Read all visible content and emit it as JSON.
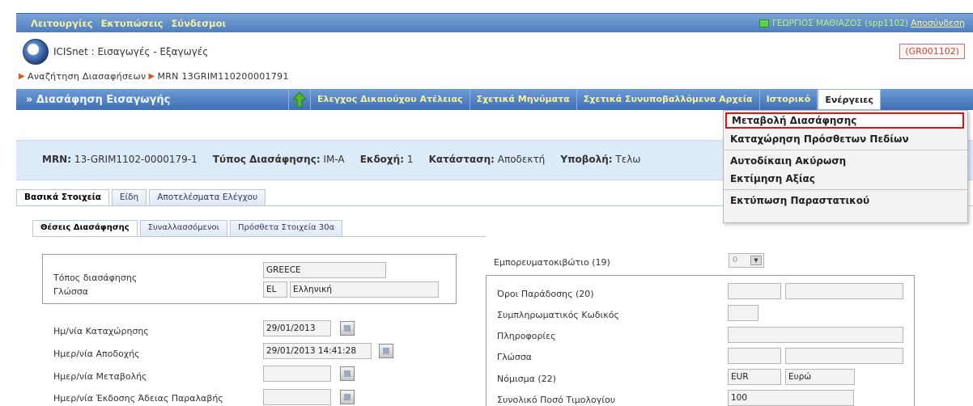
{
  "top_menu": {
    "items": [
      "Λειτουργίες",
      "Εκτυπώσεις",
      "Σύνδεσμοι"
    ],
    "user": "ΓΕΩΡΓΙΟΣ ΜΑΘΙΑΖΟΣ (spp1102)",
    "logout": "Αποσύνδεση"
  },
  "app": {
    "title": "ICISnet : Εισαγωγές - Εξαγωγές",
    "code": "(GR001102)"
  },
  "breadcrumb": [
    "Αναζήτηση Διασαφήσεων",
    "MRN 13GRIM110200001791"
  ],
  "toolbar": {
    "title": "» Διασάφηση Εισαγωγής",
    "items": [
      "Ελεγχος Δικαιούχου Ατέλειας",
      "Σχετικά Μηνύματα",
      "Σχετικά Συνυποβαλλόμενα Αρχεία",
      "Ιστορικό",
      "Ενέργειες"
    ]
  },
  "dropdown": {
    "options": [
      "Μεταβολή Διασάφησης",
      "Καταχώρηση Πρόσθετων Πεδίων",
      "Αυτοδίκαιη Ακύρωση",
      "Εκτίμηση Αξίας",
      "Εκτύπωση Παραστατικού"
    ]
  },
  "info": {
    "mrn_label": "MRN:",
    "mrn_value": "13-GRIM1102-0000179-1",
    "type_label": "Τύπος Διασάφησης:",
    "type_value": "IM-A",
    "version_label": "Εκδοχή:",
    "version_value": "1",
    "status_label": "Κατάσταση:",
    "status_value": "Αποδεκτή",
    "submit_label": "Υποβολή:",
    "submit_value": "Τελω"
  },
  "main_tabs": [
    "Βασικά Στοιχεία",
    "Είδη",
    "Αποτελέσματα Ελέγχου"
  ],
  "sub_tabs": [
    "Θέσεις Διασάφησης",
    "Συναλλασσόμενοι",
    "Πρόσθετα Στοιχεία 30α"
  ],
  "form_left": {
    "place_label": "Τόπος διασάφησης",
    "place_value": "GREECE",
    "lang_label": "Γλώσσα",
    "lang_code": "EL",
    "lang_name": "Ελληνική",
    "reg_date_label": "Ημ/νία Καταχώρησης",
    "reg_date_value": "29/01/2013",
    "accept_date_label": "Ημερ/νία Αποδοχής",
    "accept_date_value": "29/01/2013 14:41:28",
    "change_date_label": "Ημερ/νία Μεταβολής",
    "change_date_value": "",
    "issue_date_label": "Ημερ/νία Έκδοσης Άδειας Παραλαβής",
    "issue_date_value": ""
  },
  "form_right": {
    "container_label": "Εμπορευματοκιβώτιο (19)",
    "container_value": "0",
    "terms_label": "Όροι Παράδοσης (20)",
    "supp_code_label": "Συμπληρωματικός Κωδικός",
    "info_label": "Πληροφορίες",
    "lang_label": "Γλώσσα",
    "currency_label": "Νόμισμα (22)",
    "currency_code": "EUR",
    "currency_name": "Ευρώ",
    "total_label": "Συνολικό Ποσό Τιμολογίου",
    "total_value": "100"
  }
}
